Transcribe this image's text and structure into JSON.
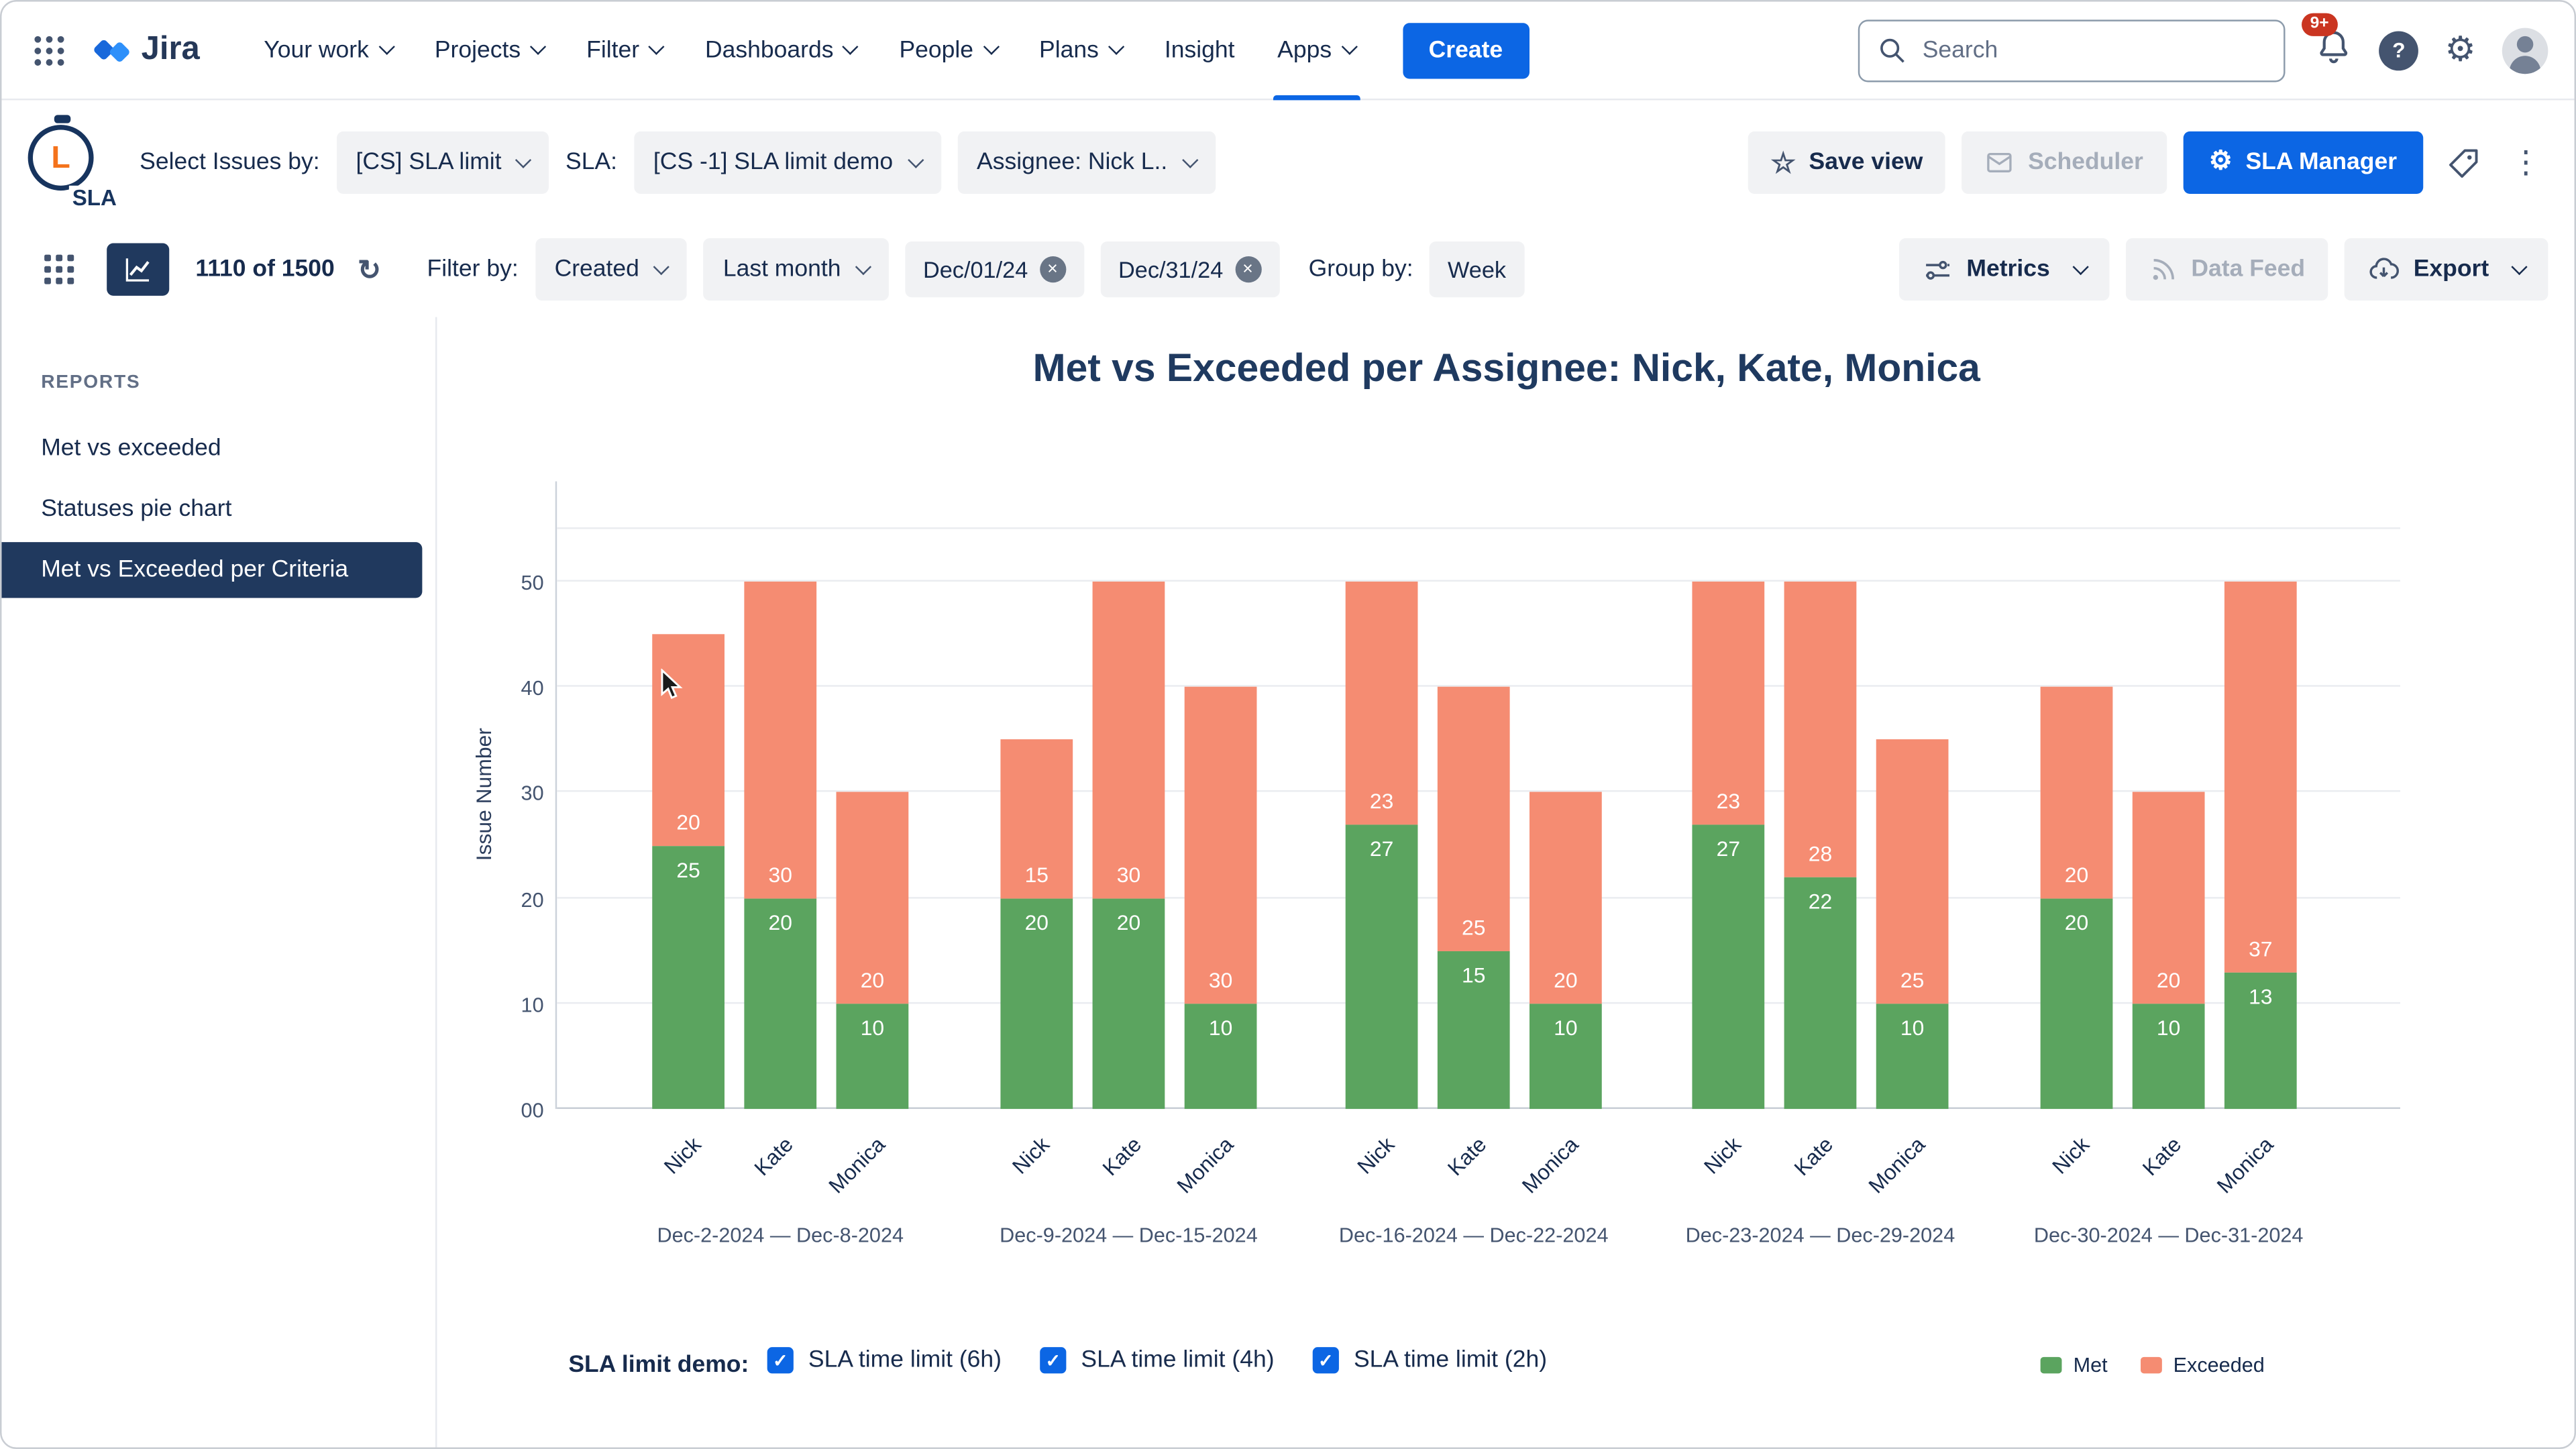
{
  "colors": {
    "accent": "#0C66E4",
    "navy": "#20395E",
    "met": "#5BA45F",
    "exceeded": "#F58C72",
    "badge": "#CA3521"
  },
  "icons": {
    "check": "✓",
    "close": "×",
    "more-vertical": "⋮",
    "refresh": "↻",
    "star": "☆",
    "gear": "⚙",
    "gear-white": "⚙",
    "help": "?"
  },
  "navbar": {
    "logo_text": "Jira",
    "items": [
      {
        "label": "Your work"
      },
      {
        "label": "Projects"
      },
      {
        "label": "Filter"
      },
      {
        "label": "Dashboards"
      },
      {
        "label": "People"
      },
      {
        "label": "Plans"
      },
      {
        "label": "Insight"
      },
      {
        "label": "Apps",
        "active": true
      }
    ],
    "create_label": "Create",
    "search_placeholder": "Search",
    "notification_badge": "9+"
  },
  "sla_toolbar": {
    "logo_text": "SLA",
    "logo_letter": "L",
    "select_issues_label": "Select Issues by:",
    "select_issues_value": "[CS] SLA limit",
    "sla_label": "SLA:",
    "sla_value": "[CS -1] SLA limit demo",
    "assignee_value": "Assignee: Nick L..",
    "save_view_label": "Save view",
    "scheduler_label": "Scheduler",
    "sla_manager_label": "SLA Manager"
  },
  "filter_toolbar": {
    "count": "1110 of 1500",
    "filter_by_label": "Filter by:",
    "created_value": "Created",
    "period_value": "Last month",
    "date_from": "Dec/01/24",
    "date_to": "Dec/31/24",
    "group_by_label": "Group by:",
    "group_by_value": "Week",
    "metrics_label": "Metrics",
    "data_feed_label": "Data Feed",
    "export_label": "Export"
  },
  "sidebar": {
    "heading": "REPORTS",
    "items": [
      {
        "label": "Met vs exceeded",
        "active": false
      },
      {
        "label": "Statuses pie chart",
        "active": false
      },
      {
        "label": "Met vs Exceeded per Criteria",
        "active": true
      }
    ]
  },
  "chart_data": {
    "type": "bar",
    "stacked": true,
    "title": "Met vs Exceeded per Assignee: Nick, Kate, Monica",
    "xlabel": "",
    "ylabel": "Issue Number",
    "ylim": [
      0,
      55
    ],
    "yticks": [
      "00",
      "10",
      "20",
      "30",
      "40",
      "50"
    ],
    "ytick_values": [
      0,
      10,
      20,
      30,
      40,
      50
    ],
    "gridlines": [
      0,
      10,
      20,
      30,
      40,
      50,
      55
    ],
    "grid": true,
    "legend_position": "bottom-right",
    "assignees": [
      "Nick",
      "Kate",
      "Monica"
    ],
    "legend": [
      {
        "label": "Met",
        "color_var": "met"
      },
      {
        "label": "Exceeded",
        "color_var": "exceeded"
      }
    ],
    "groups": [
      {
        "label": "Dec-2-2024 — Dec-8-2024",
        "bars": [
          {
            "name": "Nick",
            "met": 25,
            "exceeded": 20
          },
          {
            "name": "Kate",
            "met": 20,
            "exceeded": 30
          },
          {
            "name": "Monica",
            "met": 10,
            "exceeded": 20
          }
        ]
      },
      {
        "label": "Dec-9-2024 — Dec-15-2024",
        "bars": [
          {
            "name": "Nick",
            "met": 20,
            "exceeded": 15
          },
          {
            "name": "Kate",
            "met": 20,
            "exceeded": 30
          },
          {
            "name": "Monica",
            "met": 10,
            "exceeded": 30
          }
        ]
      },
      {
        "label": "Dec-16-2024 — Dec-22-2024",
        "bars": [
          {
            "name": "Nick",
            "met": 27,
            "exceeded": 23
          },
          {
            "name": "Kate",
            "met": 15,
            "exceeded": 25
          },
          {
            "name": "Monica",
            "met": 10,
            "exceeded": 20
          }
        ]
      },
      {
        "label": "Dec-23-2024 — Dec-29-2024",
        "bars": [
          {
            "name": "Nick",
            "met": 27,
            "exceeded": 23
          },
          {
            "name": "Kate",
            "met": 22,
            "exceeded": 28
          },
          {
            "name": "Monica",
            "met": 10,
            "exceeded": 25
          }
        ]
      },
      {
        "label": "Dec-30-2024 — Dec-31-2024",
        "bars": [
          {
            "name": "Nick",
            "met": 20,
            "exceeded": 20
          },
          {
            "name": "Kate",
            "met": 10,
            "exceeded": 20
          },
          {
            "name": "Monica",
            "met": 13,
            "exceeded": 37
          }
        ]
      }
    ]
  },
  "footer": {
    "label": "SLA limit demo:",
    "checkboxes": [
      {
        "label": "SLA time limit (6h)",
        "checked": true
      },
      {
        "label": "SLA time limit (4h)",
        "checked": true
      },
      {
        "label": "SLA time limit (2h)",
        "checked": true
      }
    ],
    "legend": [
      {
        "label": "Met",
        "color_var": "met"
      },
      {
        "label": "Exceeded",
        "color_var": "exceeded"
      }
    ]
  }
}
